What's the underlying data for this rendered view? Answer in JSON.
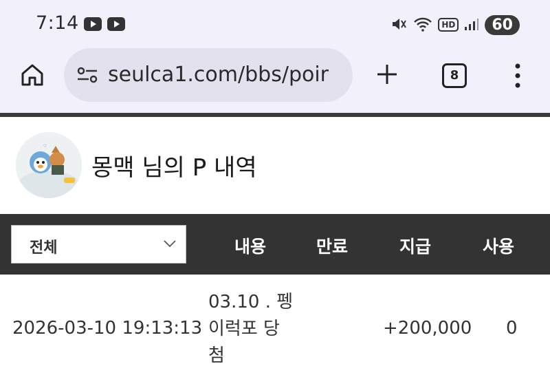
{
  "status_bar": {
    "time": "7:14",
    "battery": "60",
    "icons": [
      "youtube-icon",
      "youtube-icon",
      "mute-icon",
      "wifi-icon",
      "hd-icon",
      "signal-icon"
    ],
    "hd_label": "HD"
  },
  "browser": {
    "url": "seulca1.com/bbs/poir",
    "tab_count": "8"
  },
  "page": {
    "title": "몽맥 님의 P 내역"
  },
  "filter": {
    "selected": "전체"
  },
  "columns": {
    "content": "내용",
    "expire": "만료",
    "pay": "지급",
    "use": "사용"
  },
  "rows": [
    {
      "date": "2026-03-10 19:13:13",
      "content": "03.10 . 펭이럭포 당첨",
      "pay": "+200,000",
      "use": "0"
    }
  ],
  "colors": {
    "chrome_bg": "#f2f0fb",
    "url_bar_bg": "#e3e1ee",
    "header_bar": "#333333"
  }
}
